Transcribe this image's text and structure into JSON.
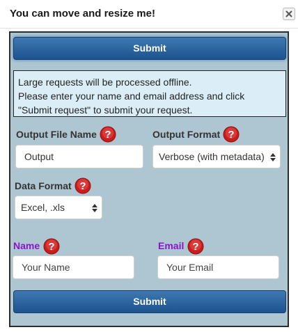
{
  "window": {
    "title": "You can move and resize me!"
  },
  "form": {
    "submit_top_label": "Submit",
    "submit_bottom_label": "Submit",
    "info_lines": [
      "Large requests will be processed offline.",
      "Please enter your name and email address and click",
      "\"Submit request\" to submit your request."
    ],
    "output_file_name": {
      "label": "Output File Name",
      "value": "Output"
    },
    "output_format": {
      "label": "Output Format",
      "selected": "Verbose (with metadata)"
    },
    "data_format": {
      "label": "Data Format",
      "selected": "Excel, .xls"
    },
    "name": {
      "label": "Name",
      "placeholder": "Your Name"
    },
    "email": {
      "label": "Email",
      "placeholder": "Your Email"
    }
  },
  "icons": {
    "close": "close-icon",
    "help": "help-icon",
    "select_arrows": "updown-arrows-icon"
  },
  "colors": {
    "panel_background": "#aec6d2",
    "button_blue": "#2a5f9a",
    "info_background": "#dbeef7",
    "help_red": "#d32222",
    "required_label_purple": "#8b14c9"
  }
}
